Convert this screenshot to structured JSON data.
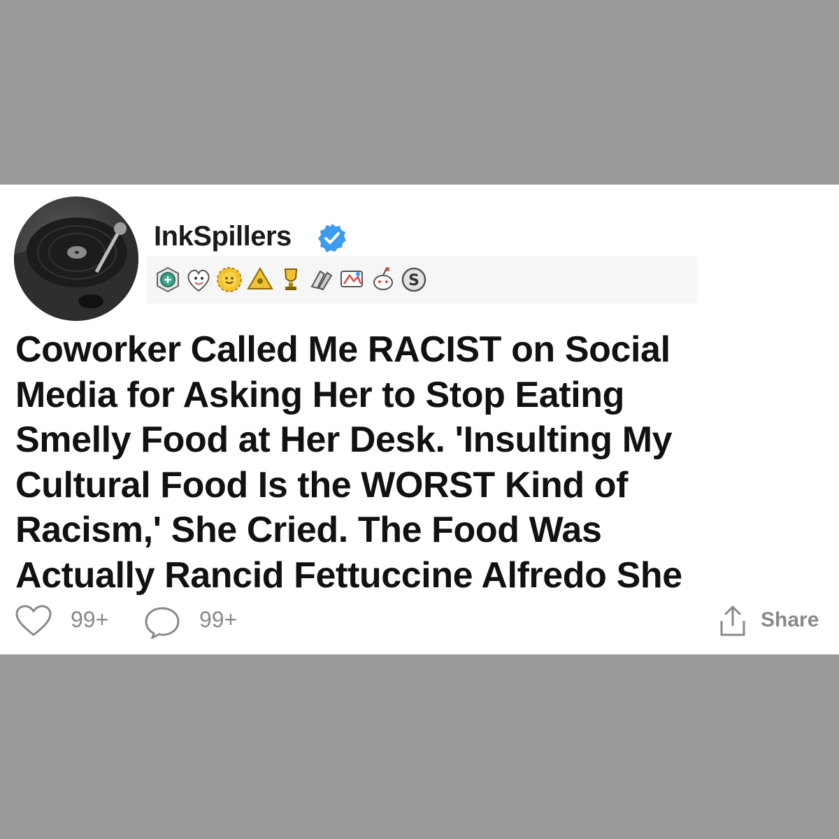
{
  "post": {
    "author": "InkSpillers",
    "verified": true,
    "awards": [
      "helpful-award",
      "wholesome-award",
      "sun-award",
      "gold-triangle-award",
      "silver-trophy-award",
      "arm-in-arm-award",
      "rocket-like-award",
      "reddit-snoo-award",
      "silver-s-award"
    ],
    "title_lines": [
      "Coworker Called Me RACIST on Social",
      "Media for Asking Her to Stop Eating",
      "Smelly Food at Her Desk. 'Insulting My",
      "Cultural Food Is the WORST Kind of",
      "Racism,' She Cried. The Food Was",
      "Actually Rancid Fettuccine Alfredo She"
    ]
  },
  "footer": {
    "likes": "99+",
    "comments": "99+",
    "share_label": "Share"
  },
  "colors": {
    "background": "#9a9a9a",
    "card": "#ffffff",
    "verified_blue": "#3d9bf0",
    "muted_text": "#878a8c"
  }
}
